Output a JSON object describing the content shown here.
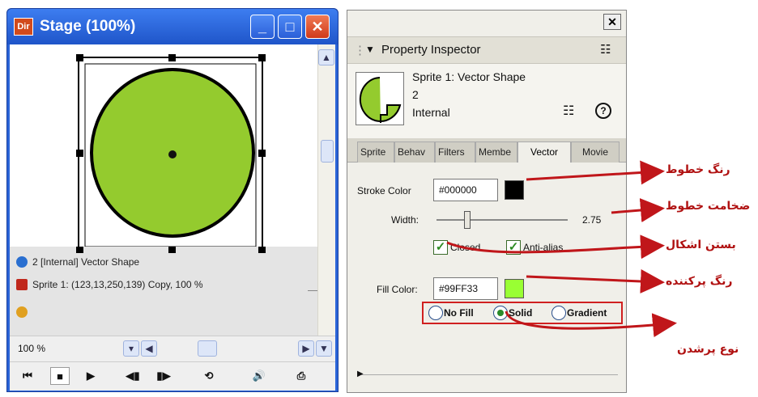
{
  "stage": {
    "title": "Stage (100%)",
    "app_icon": "Dir",
    "info_lines": [
      "2 [Internal] Vector Shape",
      "Sprite 1: (123,13,250,139) Copy, 100 %"
    ],
    "zoom": "100 %",
    "shape_color": "#94cb2e"
  },
  "inspector": {
    "header": "Property Inspector",
    "sprite_title": "Sprite 1: Vector Shape",
    "member_number": "2",
    "cast": "Internal",
    "tabs": [
      "Sprite",
      "Behav",
      "Filters",
      "Membe",
      "Vector",
      "Movie"
    ],
    "active_tab": "Vector",
    "stroke_label": "Stroke Color",
    "stroke_value": "#000000",
    "width_label": "Width:",
    "width_value": "2.75",
    "closed_label": "Closed",
    "antialias_label": "Anti-alias",
    "fill_label": "Fill Color:",
    "fill_value": "#99FF33",
    "fill_options": [
      "No Fill",
      "Solid",
      "Gradient"
    ],
    "fill_selected": "Solid"
  },
  "annotations": {
    "stroke_color": "رنگ خطوط",
    "stroke_width": "ضخامت خطوط",
    "closed": "بستن اشکال",
    "fill_color": "رنگ پرکننده",
    "fill_type": "نوع پرشدن"
  },
  "colors": {
    "annotation": "#c0161a",
    "titlebar": "#2a64d8",
    "stroke_swatch": "#000000",
    "fill_swatch": "#99ff33"
  }
}
